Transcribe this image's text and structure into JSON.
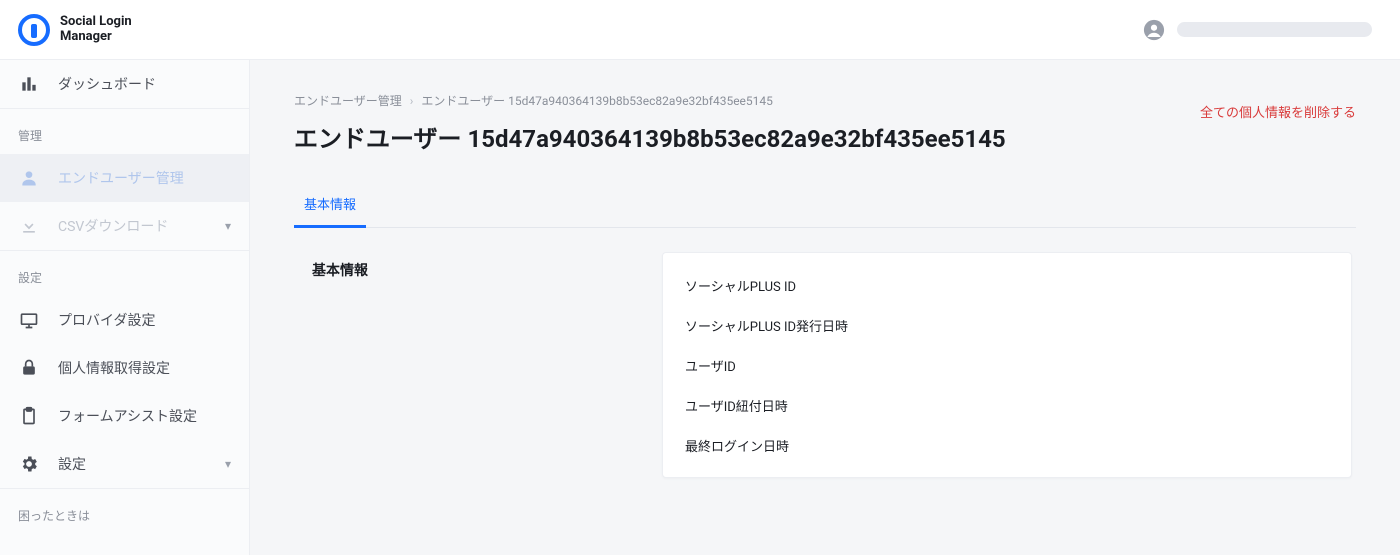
{
  "brand": {
    "line1": "Social Login",
    "line2": "Manager"
  },
  "header": {
    "account_placeholder": ""
  },
  "sidebar": {
    "dashboard": "ダッシュボード",
    "section_manage": "管理",
    "end_user_mgmt": "エンドユーザー管理",
    "csv_download": "CSVダウンロード",
    "section_settings": "設定",
    "provider_settings": "プロバイダ設定",
    "personal_info_settings": "個人情報取得設定",
    "form_assist_settings": "フォームアシスト設定",
    "settings": "設定",
    "section_help": "困ったときは"
  },
  "breadcrumb": {
    "parent": "エンドユーザー管理",
    "sep": "›",
    "current": "エンドユーザー 15d47a940364139b8b53ec82a9e32bf435ee5145"
  },
  "page": {
    "title": "エンドユーザー 15d47a940364139b8b53ec82a9e32bf435ee5145",
    "delete_all": "全ての個人情報を削除する"
  },
  "tabs": {
    "basic": "基本情報"
  },
  "detail": {
    "section_title": "基本情報",
    "rows": [
      {
        "label": "ソーシャルPLUS ID"
      },
      {
        "label": "ソーシャルPLUS ID発行日時"
      },
      {
        "label": "ユーザID"
      },
      {
        "label": "ユーザID紐付日時"
      },
      {
        "label": "最終ログイン日時"
      }
    ]
  }
}
